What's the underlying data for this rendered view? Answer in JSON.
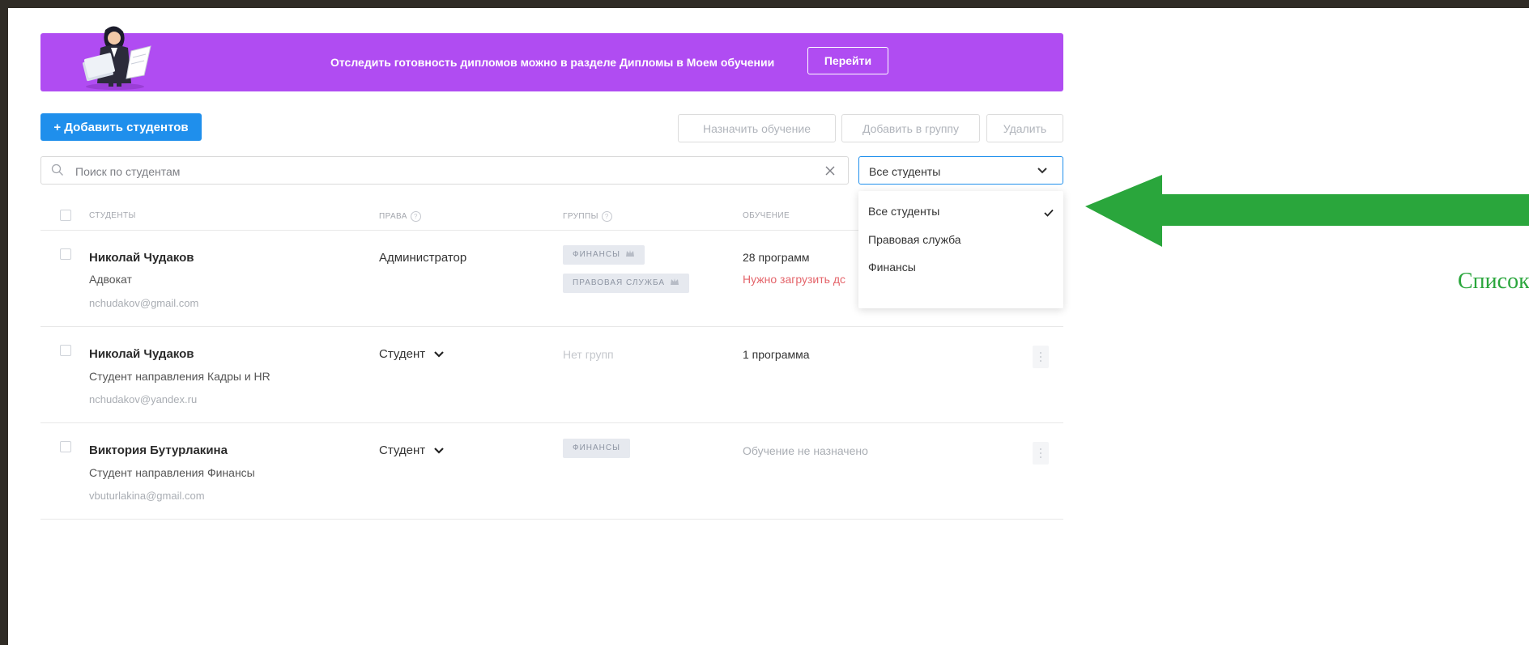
{
  "banner": {
    "text": "Отследить готовность дипломов можно в разделе Дипломы в Моем обучении",
    "button_label": "Перейти",
    "color": "#b04cf2"
  },
  "toolbar": {
    "add_label": "+ Добавить студентов",
    "assign_label": "Назначить обучение",
    "add_group_label": "Добавить в группу",
    "delete_label": "Удалить"
  },
  "search": {
    "placeholder": "Поиск по студентам",
    "value": ""
  },
  "filter": {
    "selected": "Все студенты",
    "options": [
      "Все студенты",
      "Правовая служба",
      "Финансы"
    ]
  },
  "table": {
    "headers": [
      "СТУДЕНТЫ",
      "ПРАВА",
      "ГРУППЫ",
      "ОБУЧЕНИЕ"
    ],
    "rows": [
      {
        "name": "Николай Чудаков",
        "role": "Адвокат",
        "email": "nchudakov@gmail.com",
        "rights": "Администратор",
        "groups": [
          "ФИНАНСЫ",
          "ПРАВОВАЯ СЛУЖБА"
        ],
        "education": "28 программ",
        "education_note": "Нужно загрузить дс"
      },
      {
        "name": "Николай Чудаков",
        "role": "Студент направления Кадры и HR",
        "email": "nchudakov@yandex.ru",
        "rights": "Студент",
        "groups_text": "Нет групп",
        "education": "1 программа"
      },
      {
        "name": "Виктория Бутурлакина",
        "role": "Студент направления Финансы",
        "email": "vbuturlakina@gmail.com",
        "rights": "Студент",
        "groups": [
          "ФИНАНСЫ"
        ],
        "education": "Обучение не назначено"
      }
    ]
  },
  "annotation": {
    "text": "Список групп",
    "color": "#2aa63c"
  },
  "colors": {
    "primary": "#1f8fec",
    "warning": "#e4646a"
  }
}
